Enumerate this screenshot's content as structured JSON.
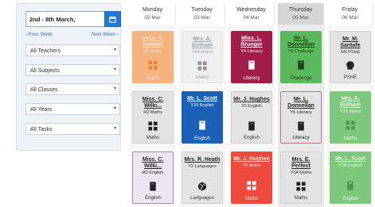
{
  "sidebar": {
    "date_value": "2nd - 8th March,",
    "prev_week": "‹ Prev. Week",
    "next_week": "Next Week ›",
    "filters": [
      "All Teachers",
      "All Subjects",
      "All Classes",
      "All Years",
      "All Tasks"
    ]
  },
  "days": [
    {
      "name": "Monday",
      "date": "02 Mar"
    },
    {
      "name": "Tuesday",
      "date": "03 Mar"
    },
    {
      "name": "Wednesday",
      "date": "04 Mar"
    },
    {
      "name": "Thursday",
      "date": "05 Mar"
    },
    {
      "name": "Friday",
      "date": "06 Mar"
    }
  ],
  "cells": [
    [
      {
        "teacher": "Miss. R. Tumbini",
        "class": "R1 Maths",
        "subject": "Maths",
        "icon": "grid-icon",
        "color": "#f6b37d"
      },
      {
        "teacher": "Miss. C. Wilki...",
        "class": "R2 Maths",
        "subject": "Maths",
        "icon": "grid-icon",
        "color": "#e3e3e3"
      },
      {
        "teacher": "Miss. C. Wilki...",
        "class": "R2 English",
        "subject": "English",
        "icon": "book-icon",
        "color": "#ebe6f2"
      }
    ],
    [
      {
        "teacher": "Mrs. A. Botham",
        "class": "Y28 Maths",
        "subject": "Maths",
        "icon": "grid-icon",
        "color": "#efefef"
      },
      {
        "teacher": "Mr. L. Scott",
        "class": "Y18 English",
        "subject": "English",
        "icon": "book-icon",
        "color": "#1b5fb7"
      },
      {
        "teacher": "Mrs. R. Heath",
        "class": "Y2 Languages",
        "subject": "Languages",
        "icon": "globe-icon",
        "color": "#e3e3e3"
      }
    ],
    [
      {
        "teacher": "Miss. L. Brunger",
        "class": "Y4 Literacy",
        "subject": "Literacy",
        "icon": "book-icon",
        "color": "#a11c48"
      },
      {
        "teacher": "Mr. J. Hughes",
        "class": "Y5 English",
        "subject": "English",
        "icon": "book-icon",
        "color": "#e3e3e3"
      },
      {
        "teacher": "Mr. J. Hughes",
        "class": "Y5 Maths",
        "subject": "Maths",
        "icon": "grid-icon",
        "color": "#ee4b3e"
      }
    ],
    [
      {
        "teacher": "Mr. L. Donnellan",
        "class": "Y6 Challenge",
        "subject": "Challenge",
        "icon": "book-icon",
        "color": "#5cb85c"
      },
      {
        "teacher": "Mr. L. Donnellan",
        "class": "Y6 Literacy",
        "subject": "Literacy",
        "icon": "book-icon",
        "color": "#e3e3e3"
      },
      {
        "teacher": "Mrs. E. Perfect",
        "class": "Y3A Maths",
        "subject": "Maths",
        "icon": "grid-icon",
        "color": "#e3e3e3"
      }
    ],
    [
      {
        "teacher": "Mr. M. Santafe",
        "class": "NN PSHE",
        "subject": "PSHE",
        "icon": "head-icon",
        "color": "#e3e3e3"
      },
      {
        "teacher": "Mrs. A. Botham",
        "class": "Y2B Maths",
        "subject": "Maths",
        "icon": "grid-icon",
        "color": "#7dc87d"
      },
      {
        "teacher": "Mr. L. Scott",
        "class": "Y1B English",
        "subject": "English",
        "icon": "book-icon",
        "color": "#7dc87d"
      }
    ]
  ]
}
